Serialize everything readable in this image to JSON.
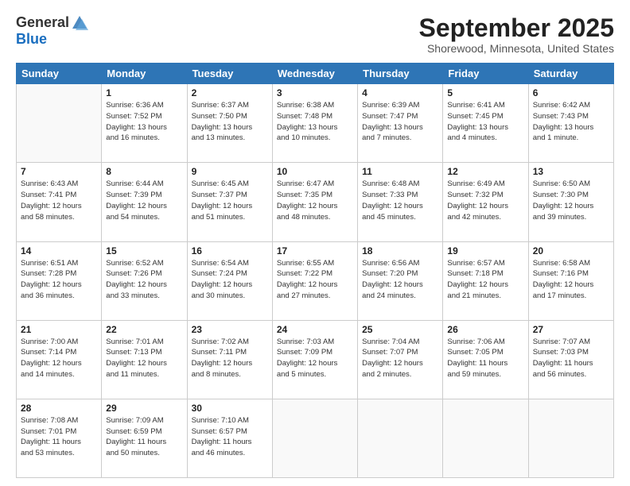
{
  "header": {
    "logo_general": "General",
    "logo_blue": "Blue",
    "cal_title": "September 2025",
    "cal_subtitle": "Shorewood, Minnesota, United States"
  },
  "days_of_week": [
    "Sunday",
    "Monday",
    "Tuesday",
    "Wednesday",
    "Thursday",
    "Friday",
    "Saturday"
  ],
  "weeks": [
    [
      {
        "day": "",
        "info": ""
      },
      {
        "day": "1",
        "info": "Sunrise: 6:36 AM\nSunset: 7:52 PM\nDaylight: 13 hours\nand 16 minutes."
      },
      {
        "day": "2",
        "info": "Sunrise: 6:37 AM\nSunset: 7:50 PM\nDaylight: 13 hours\nand 13 minutes."
      },
      {
        "day": "3",
        "info": "Sunrise: 6:38 AM\nSunset: 7:48 PM\nDaylight: 13 hours\nand 10 minutes."
      },
      {
        "day": "4",
        "info": "Sunrise: 6:39 AM\nSunset: 7:47 PM\nDaylight: 13 hours\nand 7 minutes."
      },
      {
        "day": "5",
        "info": "Sunrise: 6:41 AM\nSunset: 7:45 PM\nDaylight: 13 hours\nand 4 minutes."
      },
      {
        "day": "6",
        "info": "Sunrise: 6:42 AM\nSunset: 7:43 PM\nDaylight: 13 hours\nand 1 minute."
      }
    ],
    [
      {
        "day": "7",
        "info": "Sunrise: 6:43 AM\nSunset: 7:41 PM\nDaylight: 12 hours\nand 58 minutes."
      },
      {
        "day": "8",
        "info": "Sunrise: 6:44 AM\nSunset: 7:39 PM\nDaylight: 12 hours\nand 54 minutes."
      },
      {
        "day": "9",
        "info": "Sunrise: 6:45 AM\nSunset: 7:37 PM\nDaylight: 12 hours\nand 51 minutes."
      },
      {
        "day": "10",
        "info": "Sunrise: 6:47 AM\nSunset: 7:35 PM\nDaylight: 12 hours\nand 48 minutes."
      },
      {
        "day": "11",
        "info": "Sunrise: 6:48 AM\nSunset: 7:33 PM\nDaylight: 12 hours\nand 45 minutes."
      },
      {
        "day": "12",
        "info": "Sunrise: 6:49 AM\nSunset: 7:32 PM\nDaylight: 12 hours\nand 42 minutes."
      },
      {
        "day": "13",
        "info": "Sunrise: 6:50 AM\nSunset: 7:30 PM\nDaylight: 12 hours\nand 39 minutes."
      }
    ],
    [
      {
        "day": "14",
        "info": "Sunrise: 6:51 AM\nSunset: 7:28 PM\nDaylight: 12 hours\nand 36 minutes."
      },
      {
        "day": "15",
        "info": "Sunrise: 6:52 AM\nSunset: 7:26 PM\nDaylight: 12 hours\nand 33 minutes."
      },
      {
        "day": "16",
        "info": "Sunrise: 6:54 AM\nSunset: 7:24 PM\nDaylight: 12 hours\nand 30 minutes."
      },
      {
        "day": "17",
        "info": "Sunrise: 6:55 AM\nSunset: 7:22 PM\nDaylight: 12 hours\nand 27 minutes."
      },
      {
        "day": "18",
        "info": "Sunrise: 6:56 AM\nSunset: 7:20 PM\nDaylight: 12 hours\nand 24 minutes."
      },
      {
        "day": "19",
        "info": "Sunrise: 6:57 AM\nSunset: 7:18 PM\nDaylight: 12 hours\nand 21 minutes."
      },
      {
        "day": "20",
        "info": "Sunrise: 6:58 AM\nSunset: 7:16 PM\nDaylight: 12 hours\nand 17 minutes."
      }
    ],
    [
      {
        "day": "21",
        "info": "Sunrise: 7:00 AM\nSunset: 7:14 PM\nDaylight: 12 hours\nand 14 minutes."
      },
      {
        "day": "22",
        "info": "Sunrise: 7:01 AM\nSunset: 7:13 PM\nDaylight: 12 hours\nand 11 minutes."
      },
      {
        "day": "23",
        "info": "Sunrise: 7:02 AM\nSunset: 7:11 PM\nDaylight: 12 hours\nand 8 minutes."
      },
      {
        "day": "24",
        "info": "Sunrise: 7:03 AM\nSunset: 7:09 PM\nDaylight: 12 hours\nand 5 minutes."
      },
      {
        "day": "25",
        "info": "Sunrise: 7:04 AM\nSunset: 7:07 PM\nDaylight: 12 hours\nand 2 minutes."
      },
      {
        "day": "26",
        "info": "Sunrise: 7:06 AM\nSunset: 7:05 PM\nDaylight: 11 hours\nand 59 minutes."
      },
      {
        "day": "27",
        "info": "Sunrise: 7:07 AM\nSunset: 7:03 PM\nDaylight: 11 hours\nand 56 minutes."
      }
    ],
    [
      {
        "day": "28",
        "info": "Sunrise: 7:08 AM\nSunset: 7:01 PM\nDaylight: 11 hours\nand 53 minutes."
      },
      {
        "day": "29",
        "info": "Sunrise: 7:09 AM\nSunset: 6:59 PM\nDaylight: 11 hours\nand 50 minutes."
      },
      {
        "day": "30",
        "info": "Sunrise: 7:10 AM\nSunset: 6:57 PM\nDaylight: 11 hours\nand 46 minutes."
      },
      {
        "day": "",
        "info": ""
      },
      {
        "day": "",
        "info": ""
      },
      {
        "day": "",
        "info": ""
      },
      {
        "day": "",
        "info": ""
      }
    ]
  ]
}
